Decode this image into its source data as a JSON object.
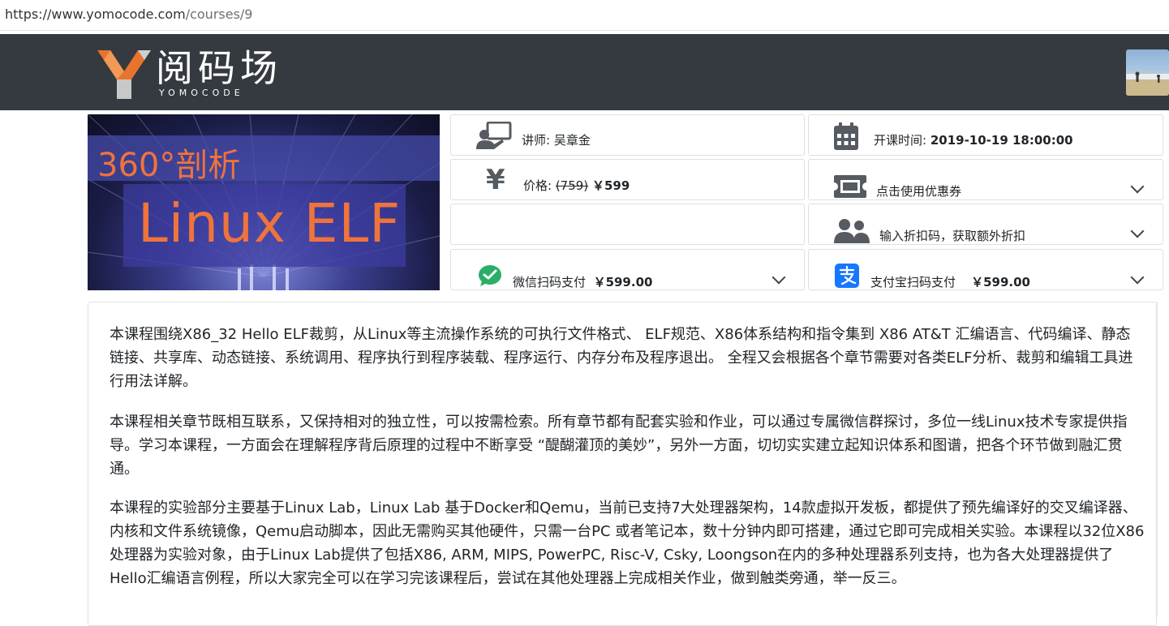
{
  "browser": {
    "url_host": "https://www.yomocode.com",
    "url_path": "/courses/9"
  },
  "header": {
    "logo_text": "阅码场",
    "logo_sub": "YOMOCODE"
  },
  "banner": {
    "title_line1": "360°剖析",
    "title_line2": "Linux ELF"
  },
  "course_info": {
    "teacher": {
      "label": "讲师: 吴章金"
    },
    "start_time": {
      "label": "开课时间: ",
      "value": "2019-10-19 18:00:00"
    },
    "price": {
      "label": "价格: ",
      "original": "(759)",
      "current": "￥599"
    },
    "coupon": {
      "label": "点击使用优惠券"
    },
    "discount": {
      "label": "输入折扣码，获取额外折扣"
    },
    "wechat_pay": {
      "label": "微信扫码支付",
      "amount": "￥599.00"
    },
    "alipay": {
      "label": "支付宝扫码支付",
      "amount": "￥599.00"
    }
  },
  "description": [
    "本课程围绕X86_32 Hello ELF裁剪，从Linux等主流操作系统的可执行文件格式、 ELF规范、X86体系结构和指令集到 X86 AT&T 汇编语言、代码编译、静态链接、共享库、动态链接、系统调用、程序执行到程序装载、程序运行、内存分布及程序退出。 全程又会根据各个章节需要对各类ELF分析、裁剪和编辑工具进行用法详解。",
    "本课程相关章节既相互联系，又保持相对的独立性，可以按需检索。所有章节都有配套实验和作业，可以通过专属微信群探讨，多位一线Linux技术专家提供指导。学习本课程，一方面会在理解程序背后原理的过程中不断享受 “醍醐灌顶的美妙”，另外一方面，切切实实建立起知识体系和图谱，把各个环节做到融汇贯通。",
    "本课程的实验部分主要基于Linux Lab，Linux Lab 基于Docker和Qemu，当前已支持7大处理器架构，14款虚拟开发板，都提供了预先编译好的交叉编译器、内核和文件系统镜像，Qemu启动脚本，因此无需购买其他硬件，只需一台PC 或者笔记本，数十分钟内即可搭建，通过它即可完成相关实验。本课程以32位X86处理器为实验对象，由于Linux Lab提供了包括X86, ARM, MIPS, PowerPC, Risc-V, Csky, Loongson在内的多种处理器系列支持，也为各大处理器提供了Hello汇编语言例程，所以大家完全可以在学习完该课程后，尝试在其他处理器上完成相关作业，做到触类旁通，举一反三。"
  ],
  "colors": {
    "nav_bg": "#343a40",
    "banner_accent": "#f0733b",
    "wechat_green": "#2aae67",
    "alipay_blue": "#1677ff",
    "icon_gray": "#555b61"
  }
}
